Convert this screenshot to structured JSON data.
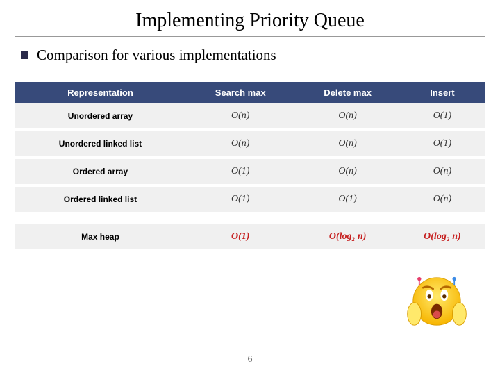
{
  "title": "Implementing Priority Queue",
  "bullet": "Comparison for various implementations",
  "page_number": "6",
  "table": {
    "headers": [
      "Representation",
      "Search max",
      "Delete max",
      "Insert"
    ],
    "rows": [
      {
        "rep": "Unordered array",
        "search": "O(n)",
        "delete": "O(n)",
        "insert": "O(1)"
      },
      {
        "rep": "Unordered linked list",
        "search": "O(n)",
        "delete": "O(n)",
        "insert": "O(1)"
      },
      {
        "rep": "Ordered array",
        "search": "O(1)",
        "delete": "O(n)",
        "insert": "O(n)"
      },
      {
        "rep": "Ordered linked list",
        "search": "O(1)",
        "delete": "O(1)",
        "insert": "O(n)"
      }
    ],
    "highlight_row": {
      "rep": "Max heap",
      "search": "O(1)",
      "delete": "O(log₂ n)",
      "insert": "O(log₂ n)"
    }
  },
  "chart_data": {
    "type": "table",
    "title": "Priority Queue implementation complexity comparison",
    "columns": [
      "Representation",
      "Search max",
      "Delete max",
      "Insert"
    ],
    "rows": [
      [
        "Unordered array",
        "O(n)",
        "O(n)",
        "O(1)"
      ],
      [
        "Unordered linked list",
        "O(n)",
        "O(n)",
        "O(1)"
      ],
      [
        "Ordered array",
        "O(1)",
        "O(n)",
        "O(n)"
      ],
      [
        "Ordered linked list",
        "O(1)",
        "O(1)",
        "O(n)"
      ],
      [
        "Max heap",
        "O(1)",
        "O(log2 n)",
        "O(log2 n)"
      ]
    ]
  }
}
